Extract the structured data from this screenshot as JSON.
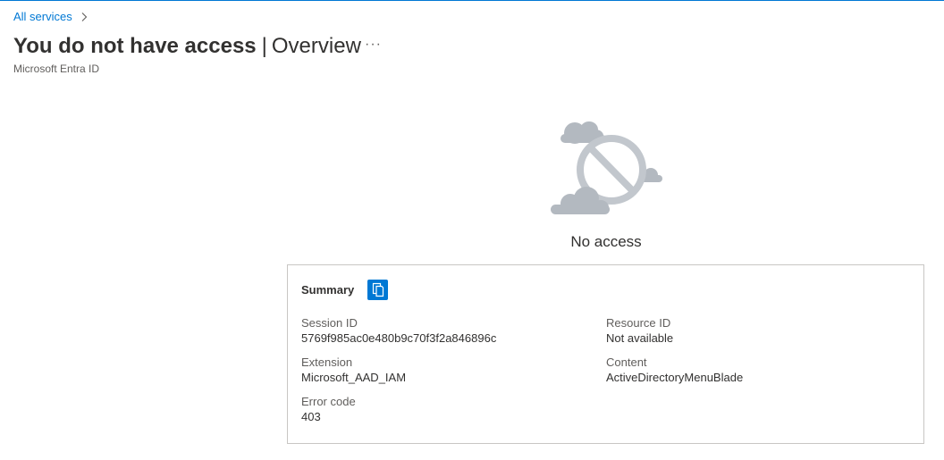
{
  "breadcrumb": {
    "items": [
      {
        "label": "All services"
      }
    ]
  },
  "header": {
    "title": "You do not have access",
    "separator": "|",
    "subtitle_page": "Overview",
    "more_label": "···",
    "service_name": "Microsoft Entra ID"
  },
  "main": {
    "illustration_icon": "no-access-cloud-icon",
    "status_text": "No access"
  },
  "summary": {
    "label": "Summary",
    "copy_icon": "copy-icon",
    "fields": {
      "session_id": {
        "key": "Session ID",
        "value": "5769f985ac0e480b9c70f3f2a846896c"
      },
      "resource_id": {
        "key": "Resource ID",
        "value": "Not available"
      },
      "extension": {
        "key": "Extension",
        "value": "Microsoft_AAD_IAM"
      },
      "content": {
        "key": "Content",
        "value": "ActiveDirectoryMenuBlade"
      },
      "error_code": {
        "key": "Error code",
        "value": "403"
      }
    }
  },
  "colors": {
    "accent": "#0078d4",
    "illustration_gray": "#b3b9c0",
    "border": "#c8c6c4"
  }
}
